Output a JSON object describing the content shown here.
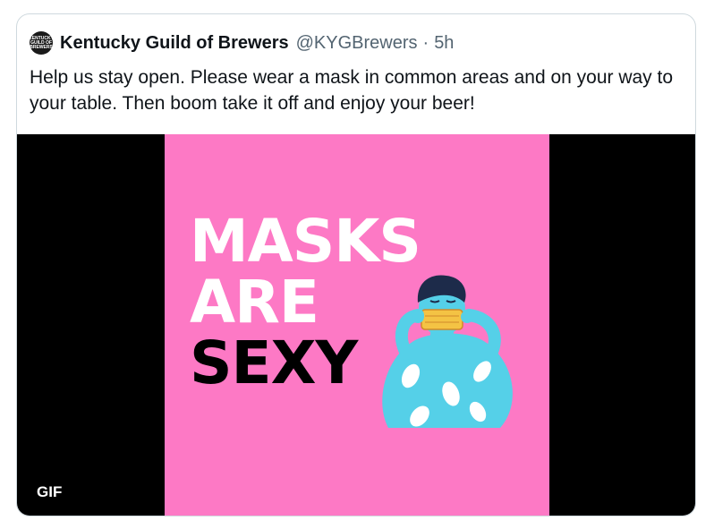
{
  "tweet": {
    "author_name": "Kentucky Guild of Brewers",
    "handle": "@KYGBrewers",
    "separator": "·",
    "time": "5h",
    "avatar_text": "KENTUCKY GUILD OF BREWERS",
    "text": "Help us stay open. Please wear a mask in common areas and on your way to your table. Then boom take it off and enjoy your beer!"
  },
  "media": {
    "headline_line1": "MASKS",
    "headline_line2": "ARE",
    "headline_line3": "SEXY",
    "badge": "GIF",
    "colors": {
      "background": "#fd79c5",
      "letterbox": "#000000",
      "shirt": "#55d0e8",
      "mask": "#f4c344"
    }
  }
}
